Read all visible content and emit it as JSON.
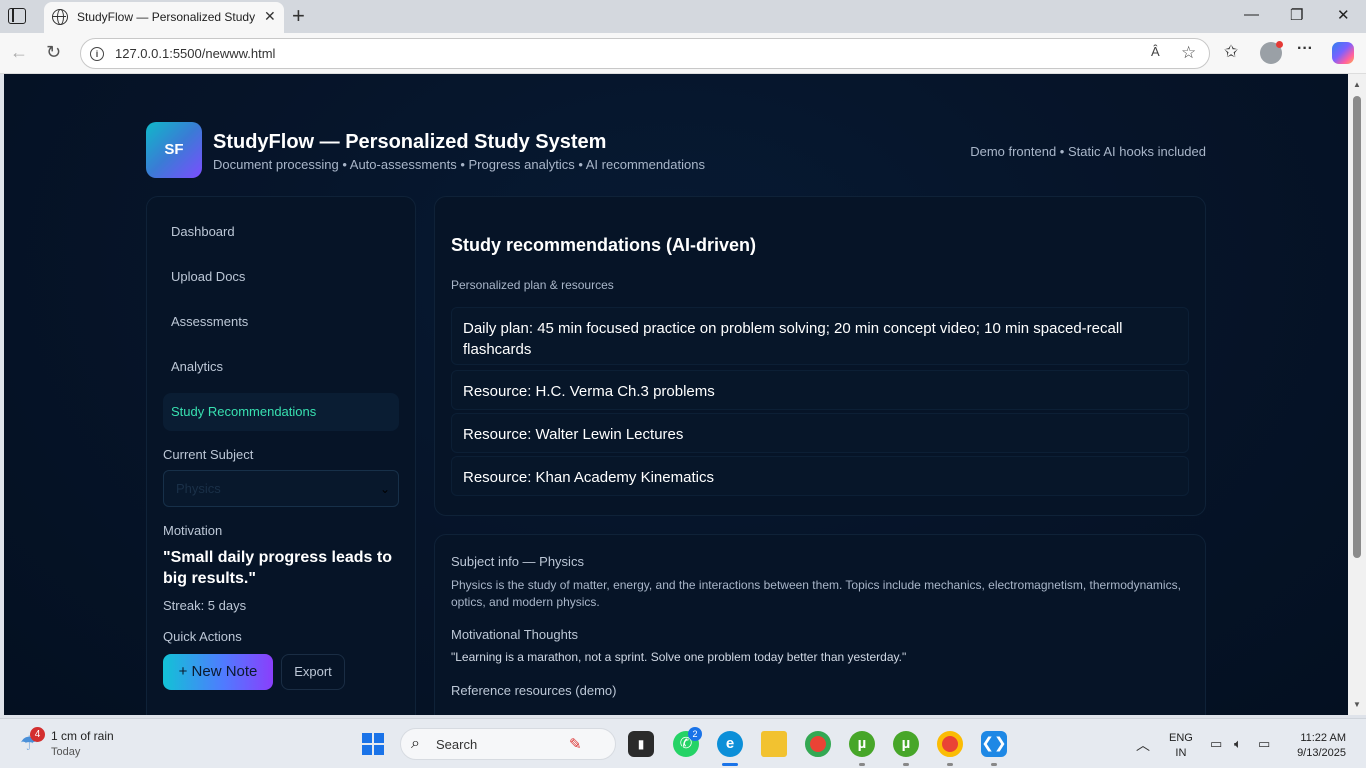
{
  "browser": {
    "tab_title": "StudyFlow — Personalized Study S",
    "tab_close": "✕",
    "new_tab": "+",
    "url": "127.0.0.1:5500/newww.html",
    "window_controls": {
      "minimize": "—",
      "restore": "❐",
      "close": "✕"
    },
    "read_aloud": "Â",
    "favorite": "☆",
    "favorites": "✩",
    "more": "···"
  },
  "app": {
    "logo": "SF",
    "title": "StudyFlow — Personalized Study System",
    "subtitle": "Document processing • Auto-assessments • Progress analytics • AI recommendations",
    "meta": "Demo frontend • Static AI hooks included"
  },
  "sidebar": {
    "items": [
      {
        "label": "Dashboard",
        "active": false
      },
      {
        "label": "Upload Docs",
        "active": false
      },
      {
        "label": "Assessments",
        "active": false
      },
      {
        "label": "Analytics",
        "active": false
      },
      {
        "label": "Study Recommendations",
        "active": true
      }
    ],
    "subject_label": "Current Subject",
    "subject_value": "Physics",
    "motivation_label": "Motivation",
    "quote": "\"Small daily progress leads to big results.\"",
    "streak": "Streak: 5 days",
    "quick_actions_label": "Quick Actions",
    "new_note": "+ New Note",
    "export": "Export"
  },
  "recommendations": {
    "title": "Study recommendations (AI-driven)",
    "subtitle": "Personalized plan & resources",
    "items": [
      "Daily plan: 45 min focused practice on problem solving; 20 min concept video; 10 min spaced-recall flashcards",
      "Resource: H.C. Verma Ch.3 problems",
      "Resource: Walter Lewin Lectures",
      "Resource: Khan Academy Kinematics"
    ]
  },
  "subject_info": {
    "heading": "Subject info — Physics",
    "description": "Physics is the study of matter, energy, and the interactions between them. Topics include mechanics, electromagnetism, thermodynamics, optics, and modern physics.",
    "thoughts_label": "Motivational Thoughts",
    "thought": "\"Learning is a marathon, not a sprint. Solve one problem today better than yesterday.\"",
    "references_label": "Reference resources (demo)"
  },
  "taskbar": {
    "weather_badge": "4",
    "weather_line1": "1 cm of rain",
    "weather_line2": "Today",
    "search_placeholder": "Search",
    "whatsapp_badge": "2",
    "lang_line1": "ENG",
    "lang_line2": "IN",
    "time": "11:22 AM",
    "date": "9/13/2025"
  },
  "colors": {
    "page_bg": "#061429",
    "accent_green": "#38e0b0",
    "gradient_start": "#12c2d6",
    "gradient_end": "#8a3ffc"
  }
}
